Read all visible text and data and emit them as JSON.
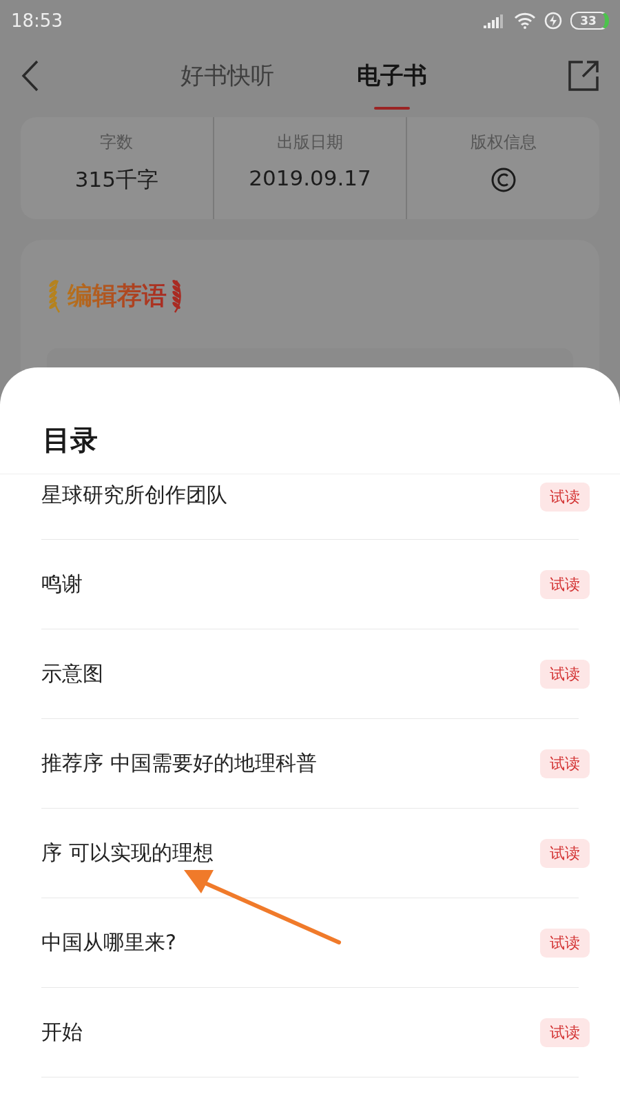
{
  "status_bar": {
    "time": "18:53",
    "battery": "33"
  },
  "header": {
    "tabs": [
      {
        "label": "好书快听",
        "selected": false
      },
      {
        "label": "电子书",
        "selected": true
      }
    ]
  },
  "stats": [
    {
      "label": "字数",
      "value": "315千字"
    },
    {
      "label": "出版日期",
      "value": "2019.09.17"
    },
    {
      "label": "版权信息",
      "kind": "icon"
    }
  ],
  "editor_card": {
    "title": "编辑荐语"
  },
  "sheet": {
    "title": "目录",
    "chapters": [
      {
        "title": "星球研究所创作团队",
        "badge": "试读"
      },
      {
        "title": "鸣谢",
        "badge": "试读"
      },
      {
        "title": "示意图",
        "badge": "试读"
      },
      {
        "title": "推荐序 中国需要好的地理科普",
        "badge": "试读"
      },
      {
        "title": "序 可以实现的理想",
        "badge": "试读"
      },
      {
        "title": "中国从哪里来?",
        "badge": "试读"
      },
      {
        "title": "开始",
        "badge": "试读"
      }
    ]
  }
}
